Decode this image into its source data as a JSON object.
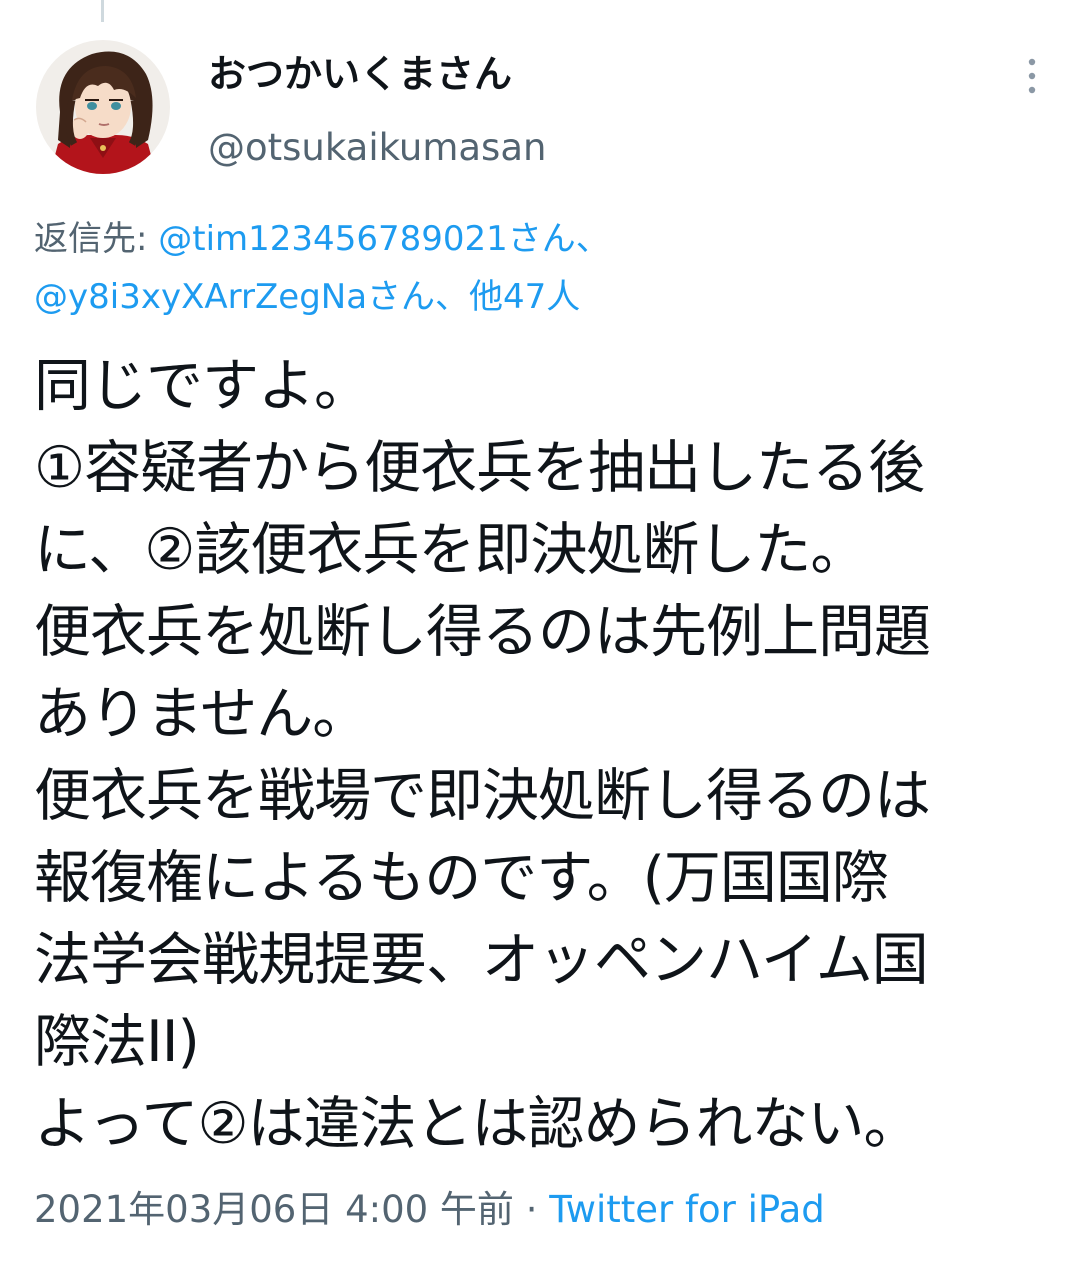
{
  "tweet": {
    "author": {
      "display_name": "おつかいくまさん",
      "handle": "@otsukaikumasan",
      "avatar_icon": "anime-girl-avatar"
    },
    "more_icon": "more-vertical-icon",
    "reply_to": {
      "prefix": "返信先: ",
      "user1": "@tim123456789021さん、",
      "user2": "@y8i3xyXArrZegNaさん、",
      "others": "他47人"
    },
    "body_lines": [
      "同じですよ。",
      "①容疑者から便衣兵を抽出したる後",
      "に、②該便衣兵を即決処断した。",
      "便衣兵を処断し得るのは先例上問題",
      "ありません。",
      "便衣兵を戦場で即決処断し得るのは",
      "報復権によるものです。(万国国際",
      "法学会戦規提要、オッペンハイム国",
      "際法II)",
      "よって②は違法とは認められない。"
    ],
    "timestamp": "2021年03月06日 4:00 午前",
    "separator": " · ",
    "source": "Twitter for iPad"
  },
  "colors": {
    "text_primary": "#0f1419",
    "text_secondary": "#536471",
    "link": "#1d9bf0",
    "thread_line": "#cfd9de"
  }
}
